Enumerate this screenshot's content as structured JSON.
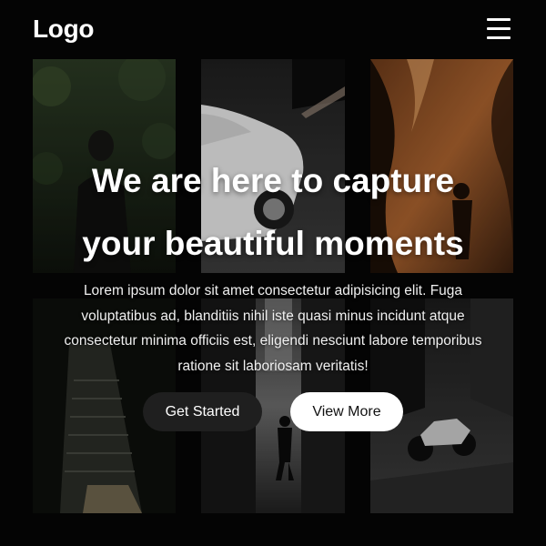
{
  "header": {
    "logo": "Logo",
    "menu_icon": "hamburger-menu-icon"
  },
  "gallery": {
    "photos": [
      "forest-portrait-photo",
      "white-car-photo",
      "canyon-silhouette-photo",
      "stairway-photo",
      "alley-walker-photo",
      "motorcycle-photo"
    ]
  },
  "hero": {
    "title_line1": "We are here to capture",
    "title_line2": "your beautiful moments",
    "description": "Lorem ipsum dolor sit amet consectetur adipisicing elit. Fuga voluptatibus ad, blanditiis nihil iste quasi minus incidunt atque consectetur minima officiis est, eligendi nesciunt labore temporibus ratione sit laboriosam veritatis!",
    "primary_button": "Get Started",
    "secondary_button": "View More"
  },
  "colors": {
    "background": "#050505",
    "primary_button_bg": "#1f1f1f",
    "secondary_button_bg": "#ffffff",
    "text": "#ffffff"
  }
}
